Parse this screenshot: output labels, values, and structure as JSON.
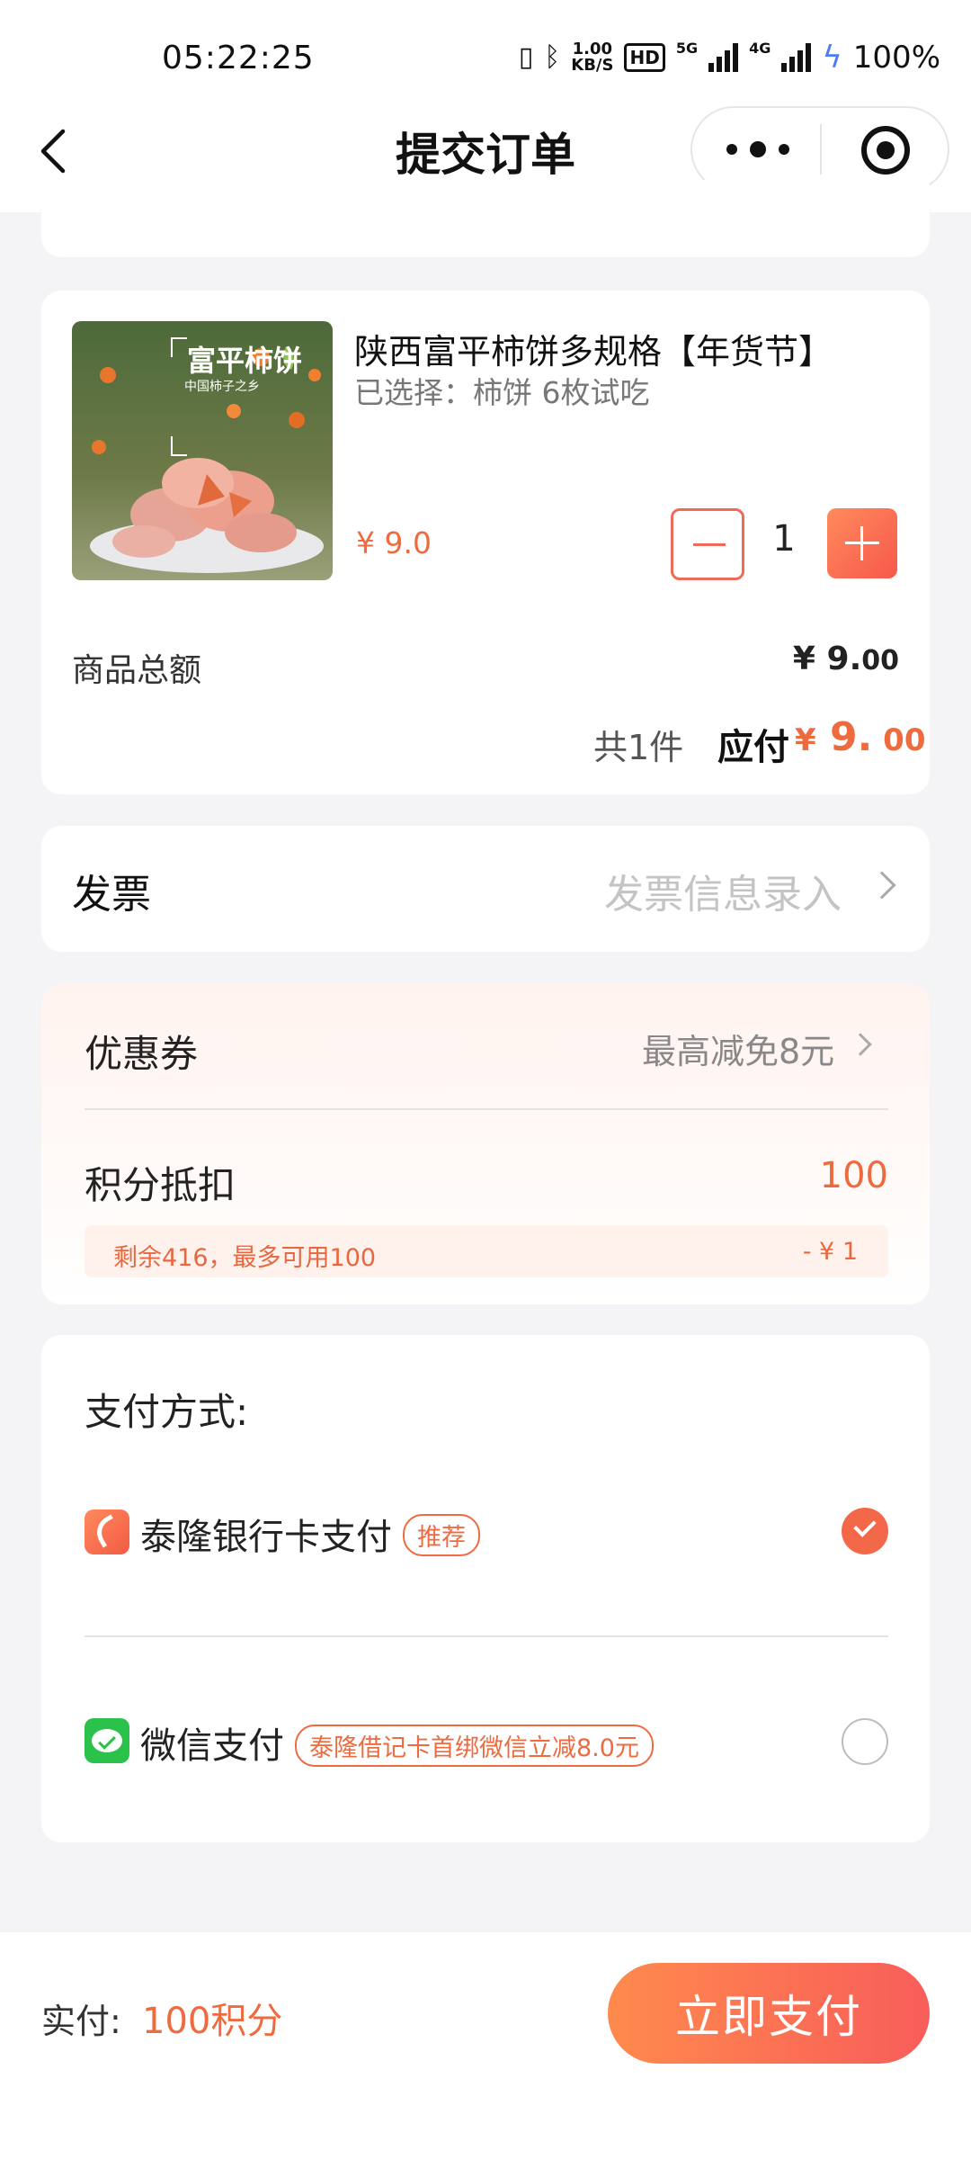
{
  "status_bar": {
    "time": "05:22:25",
    "net_speed_value": "1.00",
    "net_speed_unit": "KB/S",
    "hd_label": "HD",
    "sig1_label": "5G",
    "sig2_label": "4G",
    "battery": "100%"
  },
  "nav": {
    "title": "提交订单"
  },
  "product": {
    "title": "陕西富平柿饼多规格【年货节】",
    "spec": "已选择：柿饼 6枚试吃",
    "price": "¥ 9.0",
    "quantity": "1",
    "image_text": {
      "brand": "富平柿饼",
      "slogan": "中国柿子之乡"
    }
  },
  "summary": {
    "goods_total_label": "商品总额",
    "goods_total_currency": "¥",
    "goods_total_int": "9.",
    "goods_total_dec": "00",
    "count_text": "共1件",
    "payable_label": "应付",
    "payable_currency": "¥",
    "payable_int": "9.",
    "payable_dec": " 00"
  },
  "invoice": {
    "label": "发票",
    "placeholder": "发票信息录入"
  },
  "coupon": {
    "label": "优惠券",
    "value": "最高减免8元"
  },
  "points": {
    "label": "积分抵扣",
    "value": "100",
    "note": "剩余416，最多可用100",
    "deduct": "- ¥ 1"
  },
  "payment": {
    "title": "支付方式:",
    "methods": [
      {
        "label": "泰隆银行卡支付",
        "tag": "推荐",
        "selected": true
      },
      {
        "label": "微信支付",
        "tag": "泰隆借记卡首绑微信立减8.0元",
        "selected": false
      }
    ]
  },
  "footer": {
    "actual_label": "实付:",
    "actual_value": "100积分",
    "pay_button": "立即支付"
  },
  "colors": {
    "accent": "#ee6b40",
    "accent_gradient_start": "#ff8a4d",
    "accent_gradient_end": "#f85d5a",
    "wechat_green": "#2ac24a",
    "background": "#f4f4f6"
  }
}
